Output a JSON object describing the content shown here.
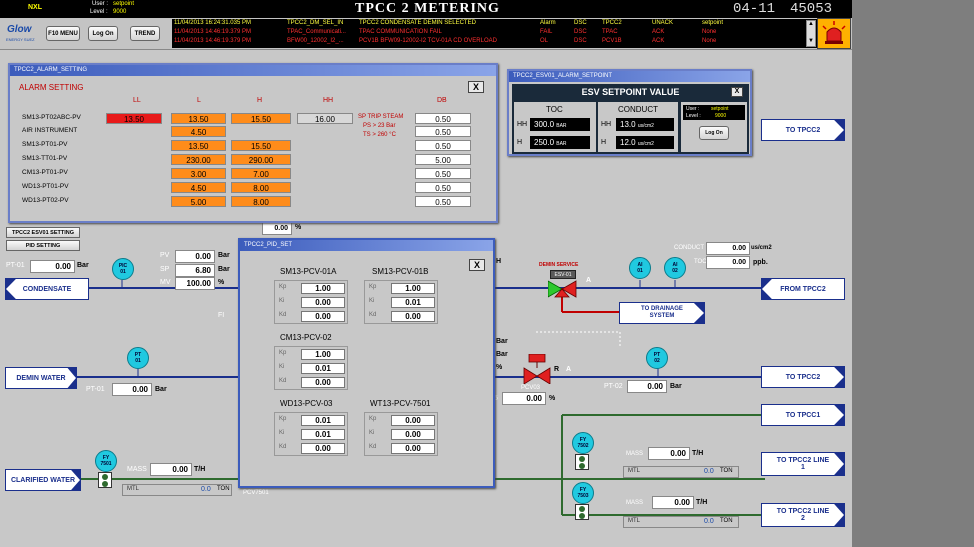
{
  "topbar": {
    "station": "NXL",
    "user_label": "User :",
    "user_value": "setpoint",
    "level_label": "Level :",
    "level_value": "9000",
    "title": "TPCC 2   METERING",
    "clock_main": "04-11",
    "clock_mid": "",
    "clock_seconds": "45053",
    "clock_suffix": ""
  },
  "menubar": {
    "logo_text": "Glow",
    "logo_sub": "ENERGY SUEZ",
    "f10_label": "F10 MENU",
    "logon_label": "Log On",
    "trend_label": "TREND",
    "alarm_rows": [
      {
        "time": "11/04/2013 16:24:31.035 PM",
        "tag": "TPCC2_DM_SEL_IN",
        "desc": "TPCC2 CONDENSATE DEMIN SELECTED",
        "type": "Alarm",
        "area": "DSC",
        "unit": "TPCC2",
        "state": "UNACK",
        "value": "setpoint",
        "color": "#ffff40"
      },
      {
        "time": "11/04/2013 14:46:19.379 PM",
        "tag": "TPAC_Communicati...",
        "desc": "TPAC COMMUNICATION FAIL",
        "type": "FAIL",
        "area": "DSC",
        "unit": "TPAC",
        "state": "ACK",
        "value": "None",
        "color": "#ff3030"
      },
      {
        "time": "11/04/2013 14:46:19.379 PM",
        "tag": "BFW00_12002_I2_...",
        "desc": "PCV1B BFW09-12002-I2 TCV-01A CD OVERLOAD",
        "type": "OL",
        "area": "DSC",
        "unit": "PCV1B",
        "state": "ACK",
        "value": "None",
        "color": "#ff3030"
      }
    ]
  },
  "alarm_window": {
    "title": "TPCC2_ALARM_SETTING",
    "heading": "ALARM SETTING",
    "headers": [
      "LL",
      "L",
      "H",
      "HH",
      "DB"
    ],
    "rows": [
      {
        "tag": "SM13-PT02ABC-PV",
        "ll": "13.50",
        "l": "13.50",
        "h": "15.50",
        "hh": "16.00",
        "db": "0.50"
      },
      {
        "tag": "AIR INSTRUMENT",
        "ll": "",
        "l": "4.50",
        "h": "",
        "hh": "",
        "db": "0.50"
      },
      {
        "tag": "SM13-PT01-PV",
        "ll": "",
        "l": "13.50",
        "h": "15.50",
        "hh": "",
        "db": "0.50"
      },
      {
        "tag": "SM13-TT01-PV",
        "ll": "",
        "l": "230.00",
        "h": "290.00",
        "hh": "",
        "db": "5.00"
      },
      {
        "tag": "CM13-PT01-PV",
        "ll": "",
        "l": "3.00",
        "h": "7.00",
        "hh": "",
        "db": "0.50"
      },
      {
        "tag": "WD13-PT01-PV",
        "ll": "",
        "l": "4.50",
        "h": "8.00",
        "hh": "",
        "db": "0.50"
      },
      {
        "tag": "WD13-PT02-PV",
        "ll": "",
        "l": "5.00",
        "h": "8.00",
        "hh": "",
        "db": "0.50"
      }
    ],
    "note_line1": "SP TRIP STEAM",
    "note_line2": "PS > 23 Bar",
    "note_line3": "TS > 260 °C"
  },
  "esv_window": {
    "title": "TPCC2_ESV01_ALARM_SETPOINT",
    "heading": "ESV SETPOINT VALUE",
    "toc_label": "TOC",
    "conduct_label": "CONDUCT",
    "hh_label": "HH",
    "h_label": "H",
    "toc_hh": "300.0",
    "toc_h": "250.0",
    "toc_unit": "BAR",
    "cond_hh": "13.0",
    "cond_h": "12.0",
    "cond_unit": "us/cm2",
    "user_label": "User :",
    "user_value": "setpoint",
    "level_label": "Level :",
    "level_value": "9000",
    "logon_label": "Log On"
  },
  "pid_window": {
    "title": "TPCC2_PID_SET",
    "k_labels": [
      "Kp",
      "Ki",
      "Kd"
    ],
    "groups": [
      {
        "name": "SM13-PCV-01A",
        "kp": "1.00",
        "ki": "0.00",
        "kd": "0.00"
      },
      {
        "name": "SM13-PCV-01B",
        "kp": "1.00",
        "ki": "0.01",
        "kd": "0.00"
      },
      {
        "name": "CM13-PCV-02",
        "kp": "1.00",
        "ki": "0.01",
        "kd": "0.00"
      },
      {
        "name": "WD13-PCV-03",
        "kp": "0.01",
        "ki": "0.01",
        "kd": "0.00"
      },
      {
        "name": "WT13-PCV-7501",
        "kp": "0.00",
        "ki": "0.00",
        "kd": "0.00"
      }
    ]
  },
  "side_buttons": {
    "esv_setting": "TPCC2 ESV01 SETTING",
    "pid_setting": "PID SETTING"
  },
  "process": {
    "pv_label": "PV",
    "pv_value": "0.00",
    "pv_unit": "Bar",
    "sp_label": "SP",
    "sp_value": "6.80",
    "sp_unit": "Bar",
    "mv_label": "MV",
    "mv_value": "100.00",
    "mv_unit": "%",
    "pt01_left_label": "PT-01",
    "pt01_left_value": "0.00",
    "pt01_left_unit": "Bar",
    "pic_tag": [
      "PIC",
      "01"
    ],
    "condensate": "CONDENSATE",
    "partial_top_value": "0.00",
    "partial_top_unit": "%",
    "partial_fi": "FI",
    "demin_water": "DEMIN WATER",
    "pt_tag": [
      "PT",
      "01"
    ],
    "pt01_bottom_label": "PT-01",
    "pt01_bottom_value": "0.00",
    "pt01_bottom_unit": "Bar",
    "clarified_water": "CLARIFIED WATER",
    "fy7501_tag": [
      "FY",
      "7501"
    ],
    "mass_label": "MASS",
    "mass_value": "0.00",
    "mass_unit": "T/H",
    "mtl_label": "MTL",
    "mtl_value": "0.0",
    "mtl_unit": "TON",
    "pcv7501": "PCV7501",
    "conduct_label": "CONDUCT",
    "conduct_value": "0.00",
    "conduct_unit": "us/cm2",
    "toc_label": "TOC",
    "toc_value": "0.00",
    "toc_unit": "ppb.",
    "demin_service": "DEMIN SERVICE",
    "esv01": "ESV-01",
    "valve_a": "A",
    "ai01_tag": [
      "AI",
      "01"
    ],
    "ai02_tag": [
      "AI",
      "02"
    ],
    "from_tpcc2": "FROM TPCC2",
    "to_drainage": "TO DRAINAGE SYSTEM",
    "bar1": "Bar",
    "bar2": "Bar",
    "pct": "%",
    "pcv03": "PCV03",
    "valve_r": "R",
    "valve_a2": "A",
    "pcv03_value": "0.00",
    "pcv03_unit": "%",
    "pt02_tag": [
      "PT",
      "02"
    ],
    "pt02_label": "PT-02",
    "pt02_value": "0.00",
    "pt02_unit": "Bar",
    "to_tpcc2_a": "TO TPCC2",
    "to_tpcc2_b": "TO TPCC2",
    "to_tpcc1": "TO TPCC1",
    "fy7502_tag": [
      "FY",
      "7502"
    ],
    "mass2_label": "MASS",
    "mass2_value": "0.00",
    "mass2_unit": "T/H",
    "mtl2_label": "MTL",
    "mtl2_value": "0.0",
    "mtl2_unit": "TON",
    "to_tpcc2_line1": "TO TPCC2 LINE 1",
    "fy7503_tag": [
      "FY",
      "7503"
    ],
    "mass3_label": "MASS",
    "mass3_value": "0.00",
    "mass3_unit": "T/H",
    "mtl3_label": "MTL",
    "mtl3_value": "0.0",
    "mtl3_unit": "TON",
    "to_tpcc2_line2": "TO TPCC2 LINE 2",
    "partial_h": "H"
  }
}
